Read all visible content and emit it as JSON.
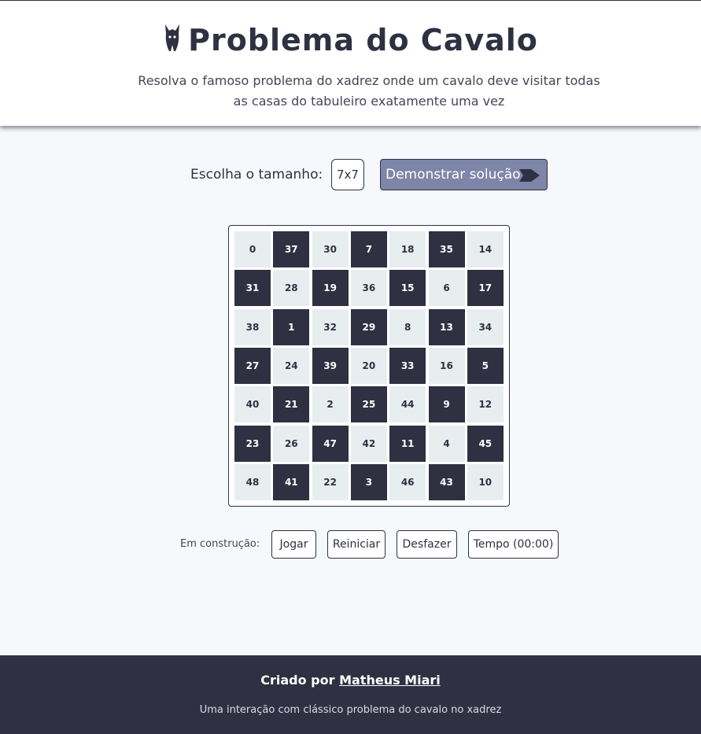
{
  "header": {
    "title": "Problema do Cavalo",
    "subtitle": "Resolva o famoso problema do xadrez onde um cavalo deve visitar todas as casas do tabuleiro exatamente uma vez",
    "logo_icon": "knight-icon"
  },
  "controls": {
    "size_label": "Escolha o tamanho:",
    "size_value": "7x7",
    "demo_label": "Demonstrar solução",
    "demo_icon": "play-arrow-icon"
  },
  "board": {
    "size": 7,
    "rows": [
      [
        "0",
        "37",
        "30",
        "7",
        "18",
        "35",
        "14"
      ],
      [
        "31",
        "28",
        "19",
        "36",
        "15",
        "6",
        "17"
      ],
      [
        "38",
        "1",
        "32",
        "29",
        "8",
        "13",
        "34"
      ],
      [
        "27",
        "24",
        "39",
        "20",
        "33",
        "16",
        "5"
      ],
      [
        "40",
        "21",
        "2",
        "25",
        "44",
        "9",
        "12"
      ],
      [
        "23",
        "26",
        "47",
        "42",
        "11",
        "4",
        "45"
      ],
      [
        "48",
        "41",
        "22",
        "3",
        "46",
        "43",
        "10"
      ]
    ],
    "light_color": "#e8edf0",
    "dark_color": "#2f3142"
  },
  "bottom": {
    "label": "Em construção:",
    "play": "Jogar",
    "restart": "Reiniciar",
    "undo": "Desfazer",
    "timer": "Tempo (00:00)"
  },
  "footer": {
    "credit_prefix": "Criado por",
    "author": "Matheus Miari",
    "note": "Uma interação com clássico problema do cavalo no xadrez"
  },
  "colors": {
    "accent": "#7d86a8",
    "primary": "#2f3142",
    "background": "#f6f9fc"
  }
}
